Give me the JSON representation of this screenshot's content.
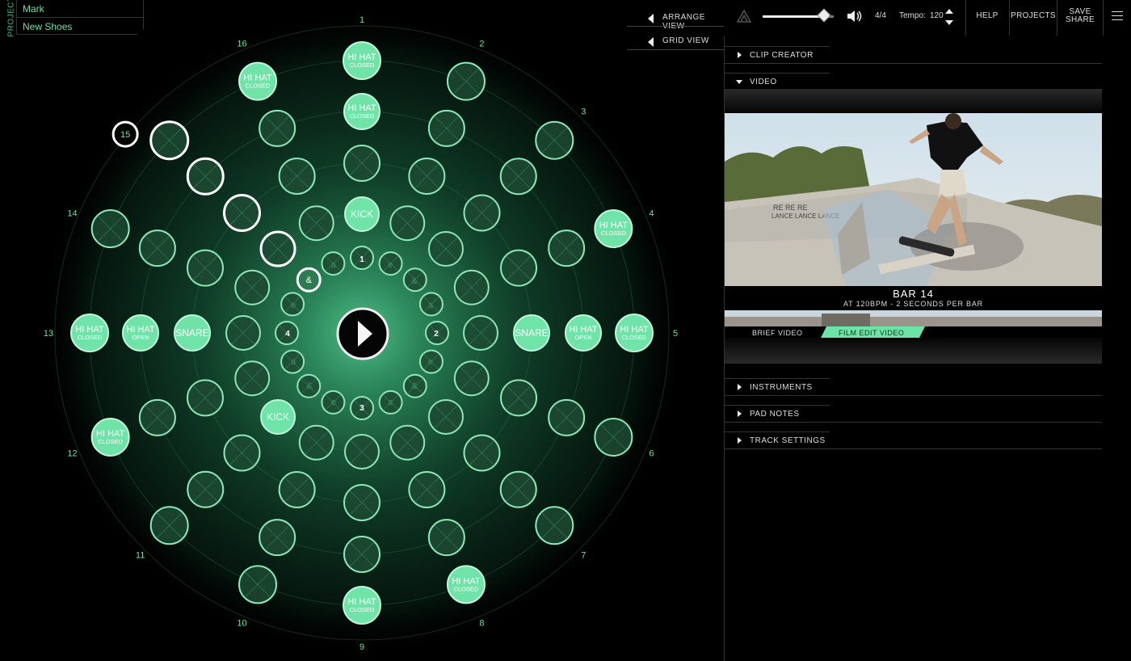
{
  "project": {
    "vertical_label": "PROJECT",
    "name": "Mark",
    "song": "New Shoes"
  },
  "views": {
    "arrange": "ARRANGE VIEW",
    "grid": "GRID VIEW"
  },
  "topbar": {
    "time_signature": "4/4",
    "tempo_label": "Tempo:",
    "tempo_value": "120",
    "help": "HELP",
    "projects": "PROJECTS",
    "save_line1": "SAVE",
    "save_line2": "SHARE",
    "volume_level": 0.82
  },
  "panel": {
    "clip_creator": "CLIP CREATOR",
    "video": "VIDEO",
    "instruments": "INSTRUMENTS",
    "pad_notes": "PAD NOTES",
    "track_settings": "TRACK SETTINGS",
    "bar_title": "BAR 14",
    "bar_sub": "AT 120BPM - 2 SECONDS PER BAR",
    "tab_brief": "BRIEF VIDEO",
    "tab_film": "FILM EDIT VIDEO"
  },
  "sequencer": {
    "step_numbers": [
      "1",
      "2",
      "3",
      "4",
      "5",
      "6",
      "7",
      "8",
      "9",
      "10",
      "11",
      "12",
      "13",
      "14",
      "15",
      "16"
    ],
    "active_step": "15",
    "beat_labels": [
      "1",
      "2",
      "3",
      "4"
    ],
    "sub_labels": [
      "e",
      "&",
      "a"
    ],
    "rings": [
      {
        "name": "ring-1",
        "pads": [
          {
            "i": 0,
            "label": "HI HAT",
            "sub": "CLOSED"
          },
          {
            "i": 3,
            "label": "HI HAT",
            "sub": "CLOSED"
          },
          {
            "i": 4,
            "label": "HI HAT",
            "sub": "CLOSED"
          },
          {
            "i": 7,
            "label": "HI HAT",
            "sub": "CLOSED"
          },
          {
            "i": 8,
            "label": "HI HAT",
            "sub": "CLOSED"
          },
          {
            "i": 11,
            "label": "HI HAT",
            "sub": "CLOSED"
          },
          {
            "i": 12,
            "label": "HI HAT",
            "sub": "CLOSED"
          },
          {
            "i": 15,
            "label": "HI HAT",
            "sub": "CLOSED"
          }
        ]
      },
      {
        "name": "ring-2",
        "pads": [
          {
            "i": 0,
            "label": "HI HAT",
            "sub": "CLOSED"
          },
          {
            "i": 4,
            "label": "HI HAT",
            "sub": "OPEN"
          },
          {
            "i": 12,
            "label": "HI HAT",
            "sub": "OPEN"
          }
        ]
      },
      {
        "name": "ring-3",
        "pads": [
          {
            "i": 4,
            "label": "SNARE",
            "sub": ""
          },
          {
            "i": 12,
            "label": "SNARE",
            "sub": ""
          }
        ]
      },
      {
        "name": "ring-4",
        "pads": [
          {
            "i": 0,
            "label": "KICK",
            "sub": ""
          },
          {
            "i": 10,
            "label": "KICK",
            "sub": ""
          }
        ]
      },
      {
        "name": "ring-5",
        "pads": [
          {
            "i": 14,
            "label": "&",
            "sub": ""
          }
        ]
      }
    ]
  }
}
